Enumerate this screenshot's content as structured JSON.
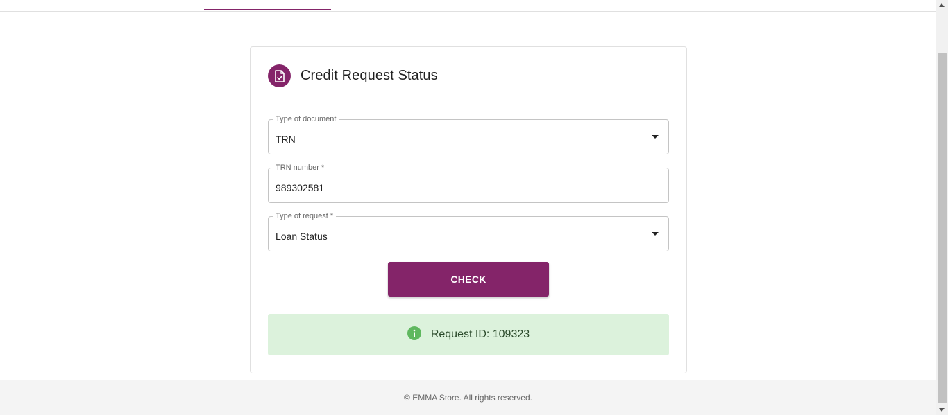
{
  "card": {
    "title": "Credit Request Status",
    "icon": "document-check-icon"
  },
  "form": {
    "document_type": {
      "label": "Type of document",
      "value": "TRN"
    },
    "trn_number": {
      "label": "TRN number *",
      "value": "989302581"
    },
    "request_type": {
      "label": "Type of request *",
      "value": "Loan Status"
    },
    "check_label": "CHECK"
  },
  "alert": {
    "icon": "info-icon",
    "text": "Request ID: 109323"
  },
  "footer": {
    "text": "© EMMA Store. All rights reserved."
  },
  "colors": {
    "brand": "#842469",
    "alert_bg": "#dcf2dc",
    "alert_icon": "#5fb85f"
  }
}
